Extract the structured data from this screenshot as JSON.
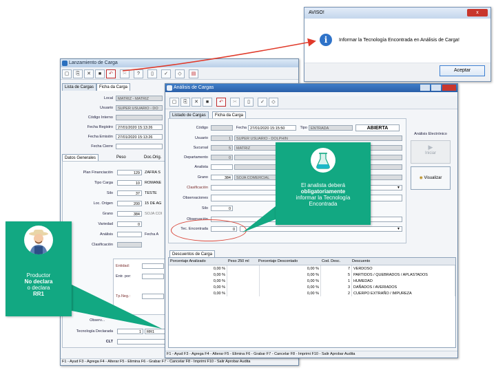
{
  "back_window": {
    "title": "Lanzamiento de Carga",
    "tabs": [
      "Lista de Cargas",
      "Ficha da Carga"
    ],
    "header_fields": [
      {
        "label": "Local",
        "value": "MATRIZ - MATRIZ"
      },
      {
        "label": "Usuario",
        "value": "SUPER USUARIO - DO"
      },
      {
        "label": "Código Interno",
        "value": ""
      },
      {
        "label": "Fecha Registro",
        "value": "27/01/2020 15:13:26"
      },
      {
        "label": "Fecha Emisión",
        "value": "27/01/2020 15:13:26"
      },
      {
        "label": "Fecha Cierre",
        "value": ""
      }
    ],
    "sub_tabs": [
      "Datos Generales",
      "Peso",
      "Doc.Orig."
    ],
    "general_fields": [
      {
        "label": "Plan Financiación",
        "code": "129",
        "desc": "ZAFRA S"
      },
      {
        "label": "Tipo Carga",
        "code": "10",
        "desc": "ROMANE"
      },
      {
        "label": "Silo",
        "code": "37",
        "desc": "TESTE"
      },
      {
        "label": "Loc. Origen",
        "code": "200",
        "desc": "15 DE AG"
      },
      {
        "label": "Grano",
        "code": "384",
        "desc": "SOJA COI"
      },
      {
        "label": "Variedad",
        "code": "0",
        "desc": ""
      },
      {
        "label": "Análisis",
        "code": "",
        "desc": ""
      },
      {
        "label": "Clasificación",
        "code": "",
        "desc": ""
      }
    ],
    "fecha_a_label": "Fecha A",
    "side_labels": [
      "Entidad:",
      "Entr. por:",
      "Tp.Neg.:"
    ],
    "observ_label": "Observ...",
    "tech_label": "Tecnología Declarada",
    "tech_code": "1",
    "tech_value": "RR1",
    "clt_label": "CLT",
    "status": "F1 - Ayud     F3 - Agrega  F4 - Alterar  F5 - Elimina  F6 - Grabar  F7 - Cancelar  F8 - Imprimi  F10 - Salir  Aprobar     Audita"
  },
  "analysis_window": {
    "title": "Análisis de Cargas",
    "tabs": [
      "Listado de Cargas",
      "Ficha da Carga"
    ],
    "codigo_label": "Código",
    "fecha_label": "Fecha",
    "fecha_value": "27/01/2020 15:15:50",
    "tipo_label": "Tipo",
    "tipo_value": "ENTRADA",
    "status_value": "ABIERTA",
    "fields": [
      {
        "label": "Usuario",
        "code": "1",
        "desc": "SUPER USUARIO - DOLPHIN"
      },
      {
        "label": "Sucursal",
        "code": "5",
        "desc": "MATRIZ"
      },
      {
        "label": "Departamento",
        "code": "0",
        "desc": ""
      },
      {
        "label": "Analista",
        "code": "",
        "desc": ""
      },
      {
        "label": "Grano",
        "code": "384",
        "desc": "SOJA COMERCIAL"
      },
      {
        "label": "Clasificación",
        "code": "",
        "desc": ""
      },
      {
        "label": "Observaciones",
        "code": "",
        "desc": ""
      },
      {
        "label": "Silo",
        "code": "0",
        "desc": ""
      },
      {
        "label": "Observación",
        "code": "",
        "desc": ""
      },
      {
        "label": "Tec. Encontrada",
        "code": "0",
        "desc": ""
      }
    ],
    "electronic_label": "Análisis Electrónico",
    "iniciar_label": "Iniciar",
    "visualizar_label": "Visualizar",
    "discount_tab": "Descuentos de Carga",
    "table_headers": [
      "Porcentaje Analizado",
      "Peso 250 ml",
      "Porcentaje Descontado",
      "Cod. Desc.",
      "Descuento"
    ],
    "table_rows": [
      {
        "pct": "0,00 %",
        "peso": "",
        "desc_pct": "0,00 %",
        "code": "7",
        "name": "VERDOSO"
      },
      {
        "pct": "0,00 %",
        "peso": "",
        "desc_pct": "0,00 %",
        "code": "5",
        "name": "PARTIDOS / QUEBRADOS / APLASTADOS"
      },
      {
        "pct": "0,00 %",
        "peso": "",
        "desc_pct": "0,00 %",
        "code": "1",
        "name": "HUMEDAD"
      },
      {
        "pct": "0,00 %",
        "peso": "",
        "desc_pct": "0,00 %",
        "code": "3",
        "name": "DAÑADOS / AVERIADOS"
      },
      {
        "pct": "0,00 %",
        "peso": "",
        "desc_pct": "0,00 %",
        "code": "2",
        "name": "CUERPO EXTRAÑO / IMPUREZA"
      }
    ],
    "status": "F1 - Ayud           F3 - Agrega  F4 - Alterar  F5 - Elimina  F6 - Grabar  F7 - Cancelar  F8 - Imprimi  F10 - Salir  Aprobar      Audita"
  },
  "dialog": {
    "title": "AVISO!",
    "close": "x",
    "message": "Informar la Tecnología Encontrada en Análisis de Carga!",
    "button": "Aceptar"
  },
  "callout_analyst": {
    "line1": "El analista deberá",
    "line2": "obligatoriamente",
    "line3": "informar la Tecnología",
    "line4": "Encontrada"
  },
  "callout_producer": {
    "line1": "Productor",
    "line2": "No declara",
    "line3": "o declara",
    "line4": "RR1"
  },
  "colors": {
    "callout_green": "#12a882",
    "arrow_red": "#e03a2a",
    "titlebar_blue": "#b9cfe8",
    "dialog_title_red": "#c8372d"
  }
}
